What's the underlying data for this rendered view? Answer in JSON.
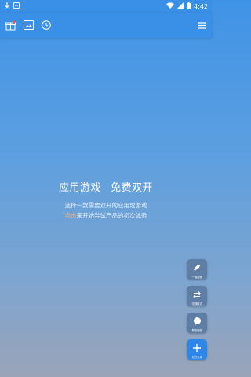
{
  "status_bar": {
    "time": "4:42",
    "icons": [
      "download-icon",
      "notification-icon",
      "wifi-icon",
      "signal-icon",
      "battery-icon"
    ]
  },
  "toolbar": {
    "icons": [
      "gift-icon",
      "image-icon",
      "clock-icon",
      "menu-icon"
    ]
  },
  "main": {
    "headline_left": "应用游戏",
    "headline_right": "免费双开",
    "desc_line1": "选择一款需要双开的应用或游戏",
    "desc_highlight": "点击",
    "desc_line2_rest": "来开始尝试产品的初次体验"
  },
  "fabs": [
    {
      "label": "一键加速",
      "icon": "rocket-icon"
    },
    {
      "label": "切换模式",
      "icon": "switch-icon"
    },
    {
      "label": "联系客服",
      "icon": "chat-icon"
    },
    {
      "label": "双开分身",
      "icon": "plus-icon"
    }
  ],
  "colors": {
    "accent": "#3a8fe6",
    "highlight": "#ffb16a"
  }
}
